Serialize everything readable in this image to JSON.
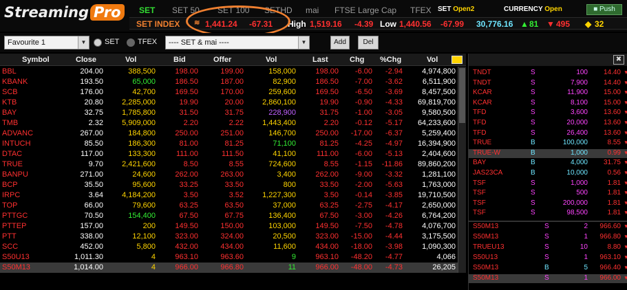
{
  "logo": {
    "text1": "Streaming",
    "text2": "Pro"
  },
  "tabs": [
    "SET",
    "SET 50",
    "SET 100",
    "SETHD",
    "mai",
    "FTSE Large Cap",
    "TFEX"
  ],
  "status": {
    "set_label": "SET",
    "set_value": "Open2",
    "currency_label": "CURRENCY",
    "currency_value": "Open",
    "push_label": "Push"
  },
  "index_bar": {
    "name": "SET INDEX",
    "value": "1,441.24",
    "change": "-67.31",
    "high_label": "High",
    "high_value": "1,519.16",
    "pct": "-4.39",
    "low_label": "Low",
    "low_value": "1,440.56",
    "low_change": "-67.99",
    "volume": "30,776.16",
    "up": "81",
    "down": "495",
    "unchanged": "32"
  },
  "controls": {
    "favourite": "Favourite 1",
    "radio_set": "SET",
    "radio_tfex": "TFEX",
    "market": "---- SET & mai ----",
    "add": "Add",
    "del": "Del"
  },
  "columns": [
    "Symbol",
    "Close",
    "Vol",
    "Bid",
    "Offer",
    "Vol",
    "Last",
    "Chg",
    "%Chg",
    "Vol"
  ],
  "colors": {
    "up": "#33ee33",
    "down": "#ff3030",
    "unchanged": "#ffd400",
    "white": "#ffffff",
    "purple": "#c060ff",
    "accent": "#f08030"
  },
  "rows": [
    {
      "sym": "BBL",
      "close": "204.00",
      "vol1": "388,500",
      "bid": "198.00",
      "offer": "199.00",
      "vol2": "158,000",
      "last": "198.00",
      "chg": "-6.00",
      "pchg": "-2.94",
      "vol3": "4,974,800",
      "c_vol1": "y",
      "c_vol2": "y"
    },
    {
      "sym": "KBANK",
      "close": "193.50",
      "vol1": "65,000",
      "bid": "186.50",
      "offer": "187.00",
      "vol2": "82,900",
      "last": "186.50",
      "chg": "-7.00",
      "pchg": "-3.62",
      "vol3": "6,511,900",
      "c_vol1": "g",
      "c_vol2": "y"
    },
    {
      "sym": "SCB",
      "close": "176.00",
      "vol1": "42,700",
      "bid": "169.50",
      "offer": "170.00",
      "vol2": "259,600",
      "last": "169.50",
      "chg": "-6.50",
      "pchg": "-3.69",
      "vol3": "8,457,500",
      "c_vol1": "y",
      "c_vol2": "y"
    },
    {
      "sym": "KTB",
      "close": "20.80",
      "vol1": "2,285,000",
      "bid": "19.90",
      "offer": "20.00",
      "vol2": "2,860,100",
      "last": "19.90",
      "chg": "-0.90",
      "pchg": "-4.33",
      "vol3": "69,819,700",
      "c_vol1": "y",
      "c_vol2": "y"
    },
    {
      "sym": "BAY",
      "close": "32.75",
      "vol1": "1,785,800",
      "bid": "31.50",
      "offer": "31.75",
      "vol2": "228,900",
      "last": "31.75",
      "chg": "-1.00",
      "pchg": "-3.05",
      "vol3": "9,580,500",
      "c_vol1": "y",
      "c_vol2": "p"
    },
    {
      "sym": "TMB",
      "close": "2.32",
      "vol1": "5,909,000",
      "bid": "2.20",
      "offer": "2.22",
      "vol2": "1,443,400",
      "last": "2.20",
      "chg": "-0.12",
      "pchg": "-5.17",
      "vol3": "64,233,600",
      "c_vol1": "y",
      "c_vol2": "y"
    },
    {
      "sym": "ADVANC",
      "close": "267.00",
      "vol1": "184,800",
      "bid": "250.00",
      "offer": "251.00",
      "vol2": "146,700",
      "last": "250.00",
      "chg": "-17.00",
      "pchg": "-6.37",
      "vol3": "5,259,400",
      "c_vol1": "y",
      "c_vol2": "y"
    },
    {
      "sym": "INTUCH",
      "close": "85.50",
      "vol1": "186,300",
      "bid": "81.00",
      "offer": "81.25",
      "vol2": "71,100",
      "last": "81.25",
      "chg": "-4.25",
      "pchg": "-4.97",
      "vol3": "16,394,900",
      "c_vol1": "y",
      "c_vol2": "g"
    },
    {
      "sym": "DTAC",
      "close": "117.00",
      "vol1": "133,300",
      "bid": "111.00",
      "offer": "111.50",
      "vol2": "41,100",
      "last": "111.00",
      "chg": "-6.00",
      "pchg": "-5.13",
      "vol3": "2,404,600",
      "c_vol1": "y",
      "c_vol2": "y"
    },
    {
      "sym": "TRUE",
      "close": "9.70",
      "vol1": "2,421,600",
      "bid": "8.50",
      "offer": "8.55",
      "vol2": "724,600",
      "last": "8.55",
      "chg": "-1.15",
      "pchg": "-11.86",
      "vol3": "89,860,200",
      "c_vol1": "y",
      "c_vol2": "y"
    },
    {
      "sym": "BANPU",
      "close": "271.00",
      "vol1": "24,600",
      "bid": "262.00",
      "offer": "263.00",
      "vol2": "3,400",
      "last": "262.00",
      "chg": "-9.00",
      "pchg": "-3.32",
      "vol3": "1,281,100",
      "c_vol1": "y",
      "c_vol2": "y"
    },
    {
      "sym": "BCP",
      "close": "35.50",
      "vol1": "95,600",
      "bid": "33.25",
      "offer": "33.50",
      "vol2": "800",
      "last": "33.50",
      "chg": "-2.00",
      "pchg": "-5.63",
      "vol3": "1,763,000",
      "c_vol1": "y",
      "c_vol2": "y"
    },
    {
      "sym": "IRPC",
      "close": "3.64",
      "vol1": "4,184,200",
      "bid": "3.50",
      "offer": "3.52",
      "vol2": "1,227,300",
      "last": "3.50",
      "chg": "-0.14",
      "pchg": "-3.85",
      "vol3": "19,710,500",
      "c_vol1": "y",
      "c_vol2": "y"
    },
    {
      "sym": "TOP",
      "close": "66.00",
      "vol1": "79,600",
      "bid": "63.25",
      "offer": "63.50",
      "vol2": "37,000",
      "last": "63.25",
      "chg": "-2.75",
      "pchg": "-4.17",
      "vol3": "2,650,000",
      "c_vol1": "y",
      "c_vol2": "y"
    },
    {
      "sym": "PTTGC",
      "close": "70.50",
      "vol1": "154,400",
      "bid": "67.50",
      "offer": "67.75",
      "vol2": "136,400",
      "last": "67.50",
      "chg": "-3.00",
      "pchg": "-4.26",
      "vol3": "6,764,200",
      "c_vol1": "g",
      "c_vol2": "y"
    },
    {
      "sym": "PTTEP",
      "close": "157.00",
      "vol1": "200",
      "bid": "149.50",
      "offer": "150.00",
      "vol2": "103,000",
      "last": "149.50",
      "chg": "-7.50",
      "pchg": "-4.78",
      "vol3": "4,076,700",
      "c_vol1": "y",
      "c_vol2": "y"
    },
    {
      "sym": "PTT",
      "close": "338.00",
      "vol1": "12,100",
      "bid": "323.00",
      "offer": "324.00",
      "vol2": "20,500",
      "last": "323.00",
      "chg": "-15.00",
      "pchg": "-4.44",
      "vol3": "3,175,500",
      "c_vol1": "y",
      "c_vol2": "y"
    },
    {
      "sym": "SCC",
      "close": "452.00",
      "vol1": "5,800",
      "bid": "432.00",
      "offer": "434.00",
      "vol2": "11,600",
      "last": "434.00",
      "chg": "-18.00",
      "pchg": "-3.98",
      "vol3": "1,090,300",
      "c_vol1": "y",
      "c_vol2": "y"
    },
    {
      "sym": "S50U13",
      "close": "1,011.30",
      "vol1": "4",
      "bid": "963.10",
      "offer": "963.60",
      "vol2": "9",
      "last": "963.10",
      "chg": "-48.20",
      "pchg": "-4.77",
      "vol3": "4,066",
      "c_vol1": "y",
      "c_vol2": "g"
    },
    {
      "sym": "S50M13",
      "close": "1,014.00",
      "vol1": "4",
      "bid": "966.00",
      "offer": "966.80",
      "vol2": "11",
      "last": "966.00",
      "chg": "-48.00",
      "pchg": "-4.73",
      "vol3": "26,205",
      "c_vol1": "y",
      "c_vol2": "g",
      "selected": true
    }
  ],
  "ticker": [
    {
      "sym": "TNDT",
      "side": "S",
      "vol": "100",
      "price": "14.40",
      "sc": "#ff3030"
    },
    {
      "sym": "TNDT",
      "side": "S",
      "vol": "7,900",
      "price": "14.40",
      "sc": "#ff3030"
    },
    {
      "sym": "KCAR",
      "side": "S",
      "vol": "11,900",
      "price": "15.00",
      "sc": "#ff3030"
    },
    {
      "sym": "KCAR",
      "side": "S",
      "vol": "8,100",
      "price": "15.00",
      "sc": "#ff3030"
    },
    {
      "sym": "TFD",
      "side": "S",
      "vol": "3,600",
      "price": "13.60",
      "sc": "#ff3030"
    },
    {
      "sym": "TFD",
      "side": "S",
      "vol": "20,000",
      "price": "13.60",
      "sc": "#ff3030"
    },
    {
      "sym": "TFD",
      "side": "S",
      "vol": "26,400",
      "price": "13.60",
      "sc": "#ff3030"
    },
    {
      "sym": "TRUE",
      "side": "B",
      "vol": "100,000",
      "price": "8.55",
      "sc": "#ff3030"
    },
    {
      "sym": "TRUE-W",
      "side": "B",
      "vol": "1,000",
      "price": "0.99",
      "sc": "#ff3030",
      "hl": true
    },
    {
      "sym": "BAY",
      "side": "B",
      "vol": "4,000",
      "price": "31.75",
      "sc": "#ff3030"
    },
    {
      "sym": "JAS23CA",
      "side": "B",
      "vol": "10,000",
      "price": "0.56",
      "sc": "#ff3030"
    },
    {
      "sym": "TSF",
      "side": "S",
      "vol": "1,000",
      "price": "1.81",
      "sc": "#ff3030"
    },
    {
      "sym": "TSF",
      "side": "S",
      "vol": "500",
      "price": "1.81",
      "sc": "#ff3030"
    },
    {
      "sym": "TSF",
      "side": "S",
      "vol": "200,000",
      "price": "1.81",
      "sc": "#ff3030"
    },
    {
      "sym": "TSF",
      "side": "S",
      "vol": "98,500",
      "price": "1.81",
      "sc": "#ff3030"
    }
  ],
  "ticker2": [
    {
      "sym": "S50M13",
      "side": "S",
      "vol": "2",
      "price": "966.60"
    },
    {
      "sym": "S50M13",
      "side": "S",
      "vol": "1",
      "price": "966.80"
    },
    {
      "sym": "TRUEU13",
      "side": "S",
      "vol": "10",
      "price": "8.80"
    },
    {
      "sym": "S50U13",
      "side": "S",
      "vol": "1",
      "price": "963.10"
    },
    {
      "sym": "S50M13",
      "side": "B",
      "vol": "5",
      "price": "966.40"
    },
    {
      "sym": "S50M13",
      "side": "S",
      "vol": "1",
      "price": "966.00",
      "hl": true
    }
  ]
}
